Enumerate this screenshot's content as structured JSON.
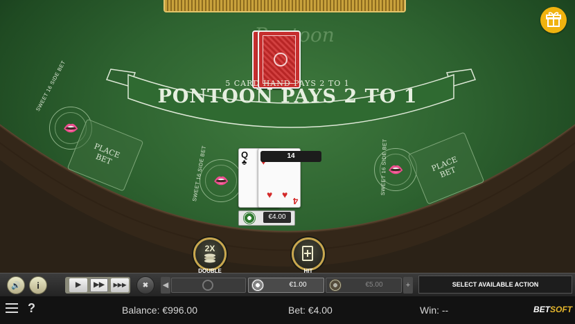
{
  "game": {
    "logo": "Pontoon",
    "rule_small": "5 CARD HAND PAYS 2 TO 1",
    "rule_big": "PONTOON PAYS 2 TO 1",
    "side_bet_label": "SWEET 16 SIDE BET",
    "place_bet_label": "PLACE BET",
    "hand_total": "14",
    "bet_amount": "€4.00",
    "cards": [
      {
        "rank": "Q",
        "suit": "♣",
        "color": "#111111"
      },
      {
        "rank": "4",
        "suit": "♥",
        "color": "#d42a2a"
      }
    ]
  },
  "actions": {
    "double_top": "2X",
    "double_label": "DOUBLE",
    "hit_label": "HIT"
  },
  "toolbar": {
    "chip_left": "€1.00",
    "chip_right": "€5.00",
    "select_action": "SELECT AVAILABLE ACTION"
  },
  "status": {
    "balance": "Balance: €996.00",
    "bet": "Bet: €4.00",
    "win": "Win: --"
  },
  "brand": {
    "bet": "BET",
    "soft": "SOFT"
  },
  "colors": {
    "felt": "#2e6330",
    "gold": "#c9a84f",
    "gift": "#f0b30f"
  }
}
